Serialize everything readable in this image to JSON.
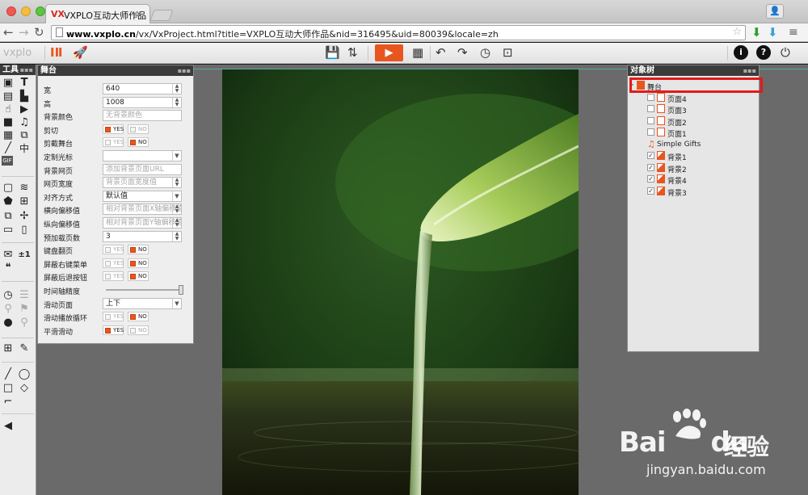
{
  "browser": {
    "tab_title": "VXPLO互动大师作品",
    "tab_logo": "VX",
    "url_host": "www.vxplo.cn",
    "url_rest": "/vx/VxProject.html?title=VXPLO互动大师作品&nid=316495&uid=80039&locale=zh"
  },
  "app": {
    "brand": "vxplo"
  },
  "tools_panel": {
    "title": "工具",
    "tools": [
      "image-tool-icon",
      "text-tool-icon",
      "document-tool-icon",
      "file-tool-icon",
      "hand-tool-icon",
      "media-tool-icon",
      "video-tool-icon",
      "music-tool-icon",
      "qrcode-tool-icon",
      "layer-tool-icon",
      "brush-tool-icon",
      "chinese-tool-icon",
      "gif-tool-icon"
    ],
    "labels": {
      "chinese_glyph": "中",
      "gif": "GIF",
      "plus_one": "±1"
    }
  },
  "stage_panel": {
    "title": "舞台",
    "rows": [
      {
        "label": "宽",
        "value": "640",
        "type": "number"
      },
      {
        "label": "高",
        "value": "1008",
        "type": "number"
      },
      {
        "label": "背景颜色",
        "value": "无背景颜色",
        "type": "text-ph"
      },
      {
        "label": "剪切",
        "type": "yn",
        "yes": true
      },
      {
        "label": "剪截舞台",
        "type": "yn",
        "yes": false
      },
      {
        "label": "定制光标",
        "value": "",
        "type": "select"
      },
      {
        "label": "背景网页",
        "value": "添加背景页面URL",
        "type": "text-ph"
      },
      {
        "label": "网页宽度",
        "value": "背景页面宽度值",
        "type": "number-ph"
      },
      {
        "label": "对齐方式",
        "value": "默认值",
        "type": "select"
      },
      {
        "label": "横向偏移值",
        "value": "相对背景页面X轴偏移值",
        "type": "number-ph"
      },
      {
        "label": "纵向偏移值",
        "value": "相对背景页面Y轴偏移值",
        "type": "number-ph"
      },
      {
        "label": "预加载页数",
        "value": "3",
        "type": "number"
      },
      {
        "label": "键盘翻页",
        "type": "yn",
        "yes": false
      },
      {
        "label": "屏蔽右键菜单",
        "type": "yn",
        "yes": false
      },
      {
        "label": "屏蔽后退按钮",
        "type": "yn",
        "yes": false
      },
      {
        "label": "时间轴精度",
        "type": "slider"
      },
      {
        "label": "滑动页面",
        "value": "上下",
        "type": "select"
      },
      {
        "label": "滑动播放循环",
        "type": "yn",
        "yes": false
      },
      {
        "label": "平滑滑动",
        "type": "yn",
        "yes": true
      }
    ],
    "yes_label": "YES",
    "no_label": "NO"
  },
  "tree_panel": {
    "title": "对象树",
    "items": [
      {
        "label": "舞台",
        "kind": "stage"
      },
      {
        "label": "页面4",
        "kind": "page",
        "checked": false
      },
      {
        "label": "页面3",
        "kind": "page",
        "checked": false
      },
      {
        "label": "页面2",
        "kind": "page",
        "checked": false
      },
      {
        "label": "页面1",
        "kind": "page",
        "checked": false
      },
      {
        "label": "Simple Gifts",
        "kind": "music"
      },
      {
        "label": "背景1",
        "kind": "image",
        "checked": true
      },
      {
        "label": "背景2",
        "kind": "image",
        "checked": true
      },
      {
        "label": "背景4",
        "kind": "image",
        "checked": true
      },
      {
        "label": "背景3",
        "kind": "image",
        "checked": true
      }
    ]
  },
  "watermark": {
    "bai": "Bai",
    "du": "du",
    "jingyan": "经验",
    "url": "jingyan.baidu.com"
  },
  "colors": {
    "accent": "#e8561f",
    "highlight": "#e21a1a"
  }
}
